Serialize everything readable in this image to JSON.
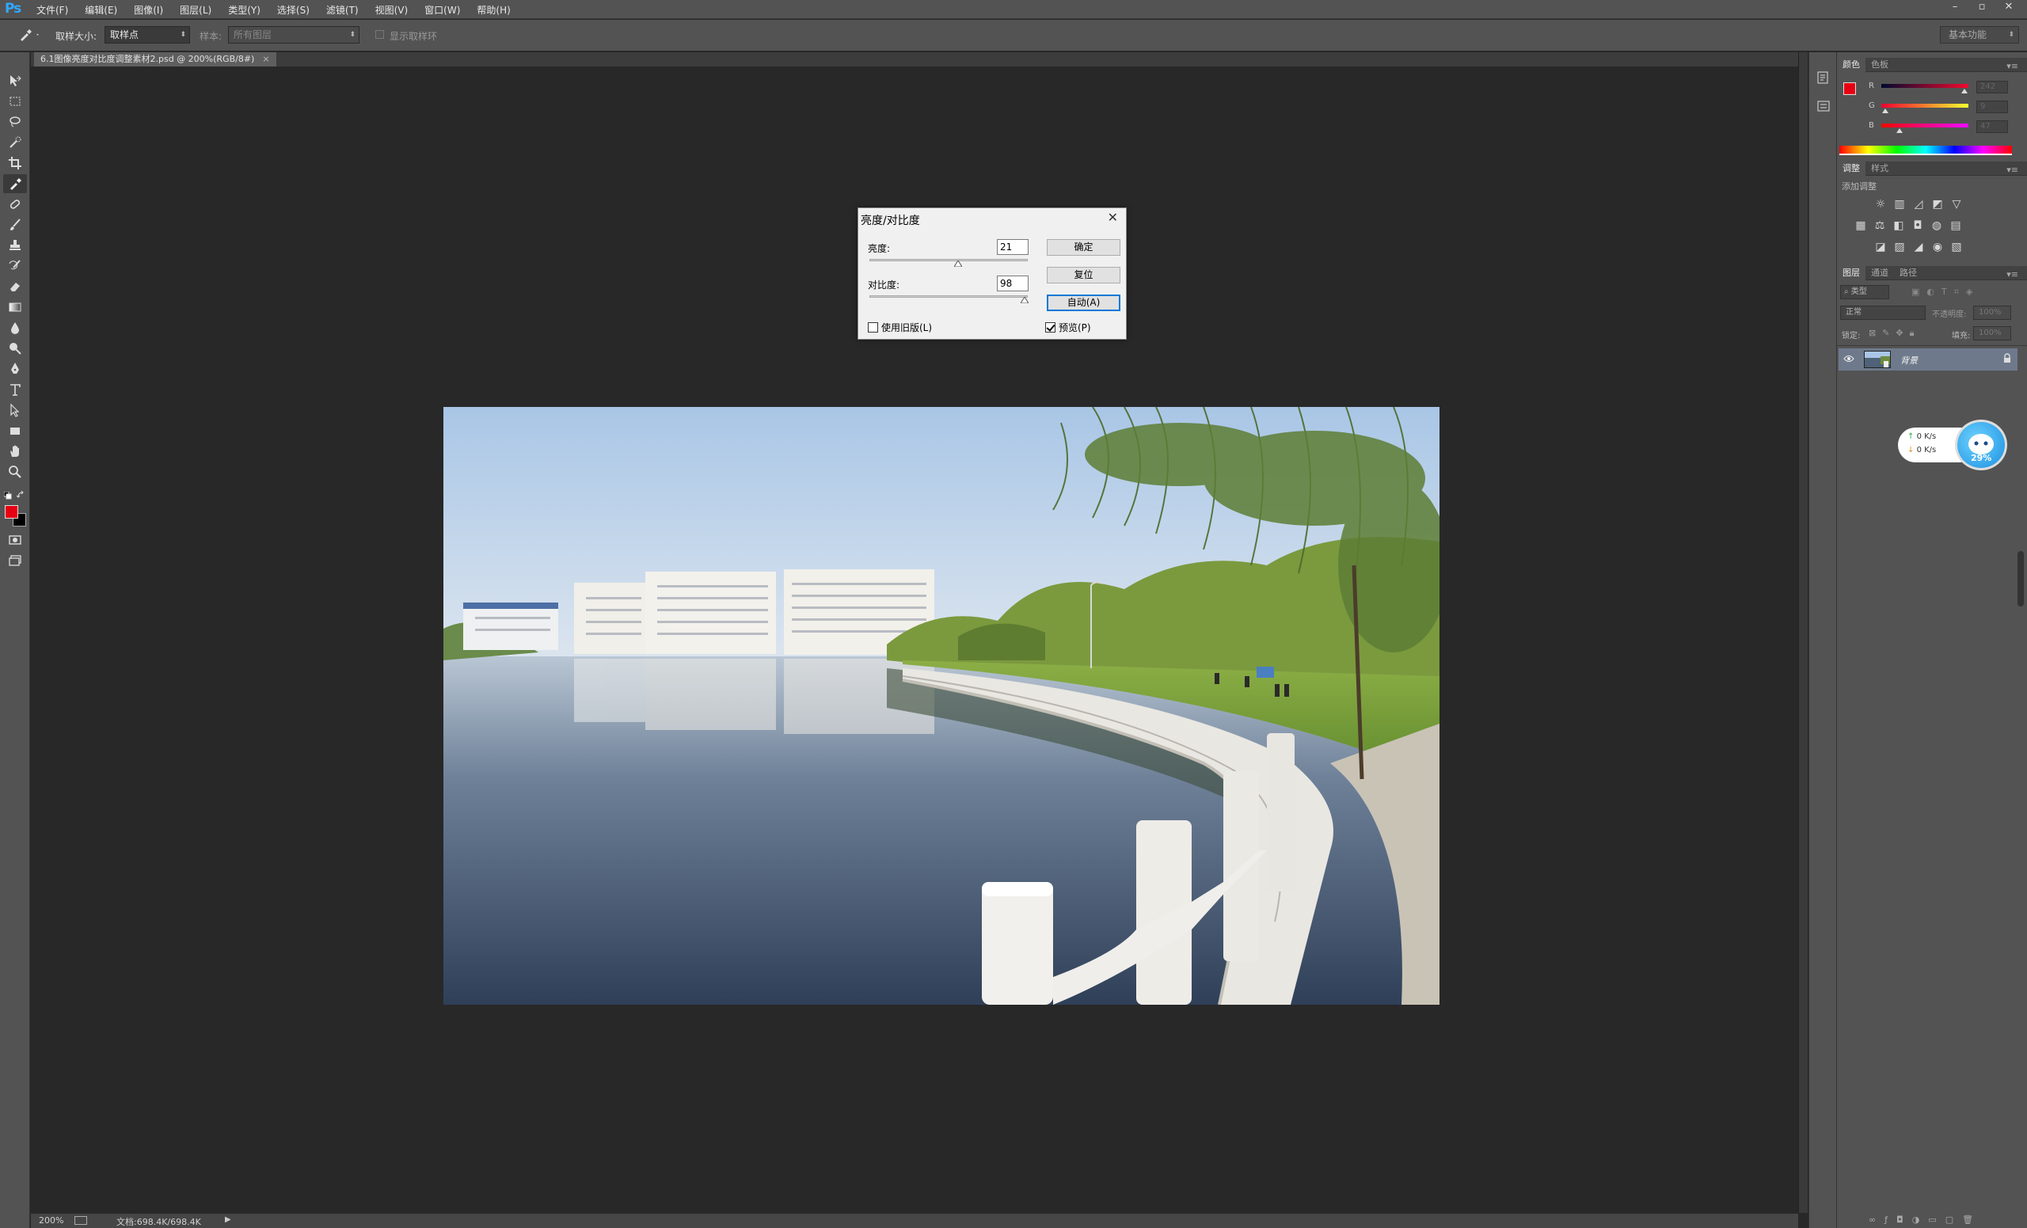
{
  "app": {
    "logo": "Ps"
  },
  "menu": [
    "文件(F)",
    "编辑(E)",
    "图像(I)",
    "图层(L)",
    "类型(Y)",
    "选择(S)",
    "滤镜(T)",
    "视图(V)",
    "窗口(W)",
    "帮助(H)"
  ],
  "window_controls": [
    "–",
    "▫",
    "✕"
  ],
  "options": {
    "sample_size_label": "取样大小:",
    "sample_size_value": "取样点",
    "sample_label": "样本:",
    "sample_value": "所有图层",
    "show_ring_label": "显示取样环",
    "workspace": "基本功能"
  },
  "document": {
    "tab_title": "6.1图像亮度对比度调整素材2.psd @ 200%(RGB/8#)",
    "tab_close": "×"
  },
  "status": {
    "zoom": "200%",
    "doc_info": "文档:698.4K/698.4K",
    "arrow": "▶"
  },
  "colors": {
    "foreground": "#e60012",
    "background": "#000000",
    "accent": "#31a8ff"
  },
  "color_panel": {
    "tabs": [
      "颜色",
      "色板"
    ],
    "r_label": "R",
    "r_value": "242",
    "g_label": "G",
    "g_value": "9",
    "b_label": "B",
    "b_value": "47"
  },
  "adjust_panel": {
    "tabs": [
      "调整",
      "样式"
    ],
    "title": "添加调整",
    "icons": [
      "brightness-contrast-icon",
      "levels-icon",
      "curves-icon",
      "exposure-icon",
      "vibrance-icon",
      "hue-saturation-icon",
      "color-balance-icon",
      "black-white-icon",
      "photo-filter-icon",
      "channel-mixer-icon",
      "color-lookup-icon",
      "invert-icon",
      "posterize-icon",
      "threshold-icon",
      "selective-color-icon",
      "gradient-map-icon"
    ]
  },
  "layers_panel": {
    "tabs": [
      "图层",
      "通道",
      "路径"
    ],
    "filter_kind": "类型",
    "blend_mode": "正常",
    "opacity_label": "不透明度:",
    "opacity_value": "100%",
    "lock_label": "锁定:",
    "fill_label": "填充:",
    "fill_value": "100%",
    "layer_name": "背景"
  },
  "net_widget": {
    "up": "0",
    "up_unit": "K/s",
    "down": "0",
    "down_unit": "K/s",
    "percent": "29%"
  },
  "dialog": {
    "title": "亮度/对比度",
    "close": "✕",
    "brightness_label": "亮度:",
    "brightness_value": "21",
    "contrast_label": "对比度:",
    "contrast_value": "98",
    "brightness_level": 0.56,
    "contrast_level": 0.98,
    "ok": "确定",
    "reset": "复位",
    "auto": "自动(A)",
    "legacy_label": "使用旧版(L)",
    "legacy_checked": false,
    "preview_label": "预览(P)",
    "preview_checked": true
  }
}
